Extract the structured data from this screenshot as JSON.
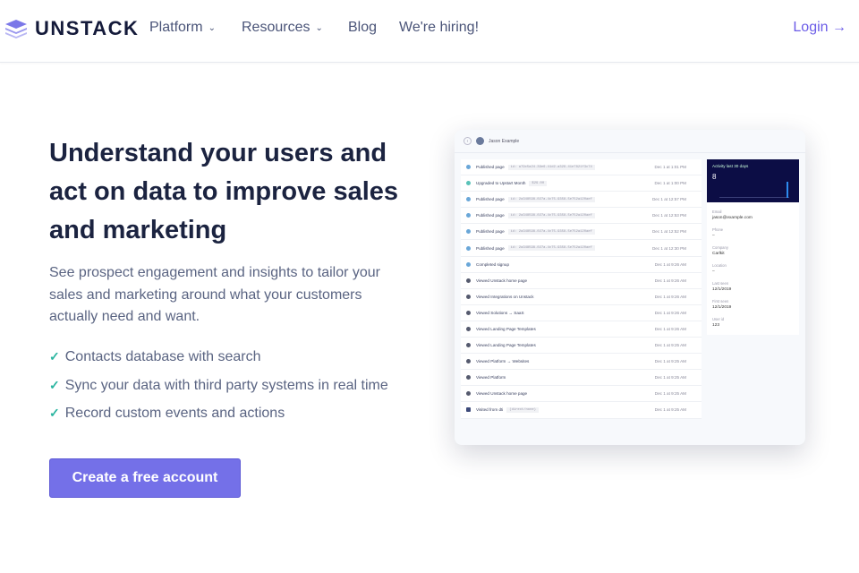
{
  "nav": {
    "brand": "UNSTACK",
    "items": [
      {
        "label": "Platform",
        "dropdown": true
      },
      {
        "label": "Resources",
        "dropdown": true
      },
      {
        "label": "Blog",
        "dropdown": false
      },
      {
        "label": "We're hiring!",
        "dropdown": false
      }
    ],
    "login": "Login →"
  },
  "hero": {
    "headline": "Understand your users and act on data to improve sales and marketing",
    "description": "See prospect engagement and insights to tailor your sales and marketing around what your customers actually need and want.",
    "features": [
      "Contacts database with search",
      "Sync your data with third party systems in real time",
      "Record custom events and actions"
    ],
    "cta": "Create a free account"
  },
  "mockup": {
    "contact_name": "Jason Example",
    "events": [
      {
        "label": "Published page",
        "code": "id: a79c5a24-39e6-41d2-a329-41e7821f3c74",
        "time": "Dec 1 at 1:01 PM",
        "icon": "page",
        "color": "#6aa7d8"
      },
      {
        "label": "Upgraded to Upstart Month",
        "code": "$29.00",
        "time": "Dec 1 at 1:00 PM",
        "icon": "upgrade",
        "color": "#59c2b8"
      },
      {
        "label": "Published page",
        "code": "id: 2a348598-027a-4c75-9358-5e752a120aef",
        "time": "Dec 1 at 12:57 PM",
        "icon": "page",
        "color": "#6aa7d8"
      },
      {
        "label": "Published page",
        "code": "id: 2a348598-027a-4c75-9358-5e752a120aef",
        "time": "Dec 1 at 12:53 PM",
        "icon": "page",
        "color": "#6aa7d8"
      },
      {
        "label": "Published page",
        "code": "id: 2a348598-027a-4c75-9358-5e752a120aef",
        "time": "Dec 1 at 12:52 PM",
        "icon": "page",
        "color": "#6aa7d8"
      },
      {
        "label": "Published page",
        "code": "id: 2a348598-027a-4c75-9358-5e752a120aef",
        "time": "Dec 1 at 12:30 PM",
        "icon": "page",
        "color": "#6aa7d8"
      },
      {
        "label": "Completed signup",
        "code": "",
        "time": "Dec 1 at 9:26 AM",
        "icon": "signup",
        "color": "#6aa7d8"
      },
      {
        "label": "Viewed Unstack home page",
        "code": "",
        "time": "Dec 1 at 9:26 AM",
        "icon": "eye",
        "color": "#555a6e"
      },
      {
        "label": "Viewed Integrations on Unstack",
        "code": "",
        "time": "Dec 1 at 9:26 AM",
        "icon": "eye",
        "color": "#555a6e"
      },
      {
        "label": "Viewed Solutions → SaaS",
        "code": "",
        "time": "Dec 1 at 9:26 AM",
        "icon": "eye",
        "color": "#555a6e"
      },
      {
        "label": "Viewed Landing Page Templates",
        "code": "",
        "time": "Dec 1 at 9:26 AM",
        "icon": "eye",
        "color": "#555a6e"
      },
      {
        "label": "Viewed Landing Page Templates",
        "code": "",
        "time": "Dec 1 at 9:25 AM",
        "icon": "eye",
        "color": "#555a6e"
      },
      {
        "label": "Viewed Platform → Websites",
        "code": "",
        "time": "Dec 1 at 9:25 AM",
        "icon": "eye",
        "color": "#555a6e"
      },
      {
        "label": "Viewed Platform",
        "code": "",
        "time": "Dec 1 at 9:25 AM",
        "icon": "eye",
        "color": "#555a6e"
      },
      {
        "label": "Viewed Unstack home page",
        "code": "",
        "time": "Dec 1 at 9:25 AM",
        "icon": "eye",
        "color": "#555a6e"
      },
      {
        "label": "Visited from dti",
        "code": "(direct/none)",
        "time": "Dec 1 at 9:25 AM",
        "icon": "calendar",
        "color": "#3d4a7a"
      }
    ],
    "activity": {
      "title": "Activity last 30 days",
      "count": "8"
    },
    "fields": [
      {
        "label": "Email",
        "value": "jason@example.com"
      },
      {
        "label": "Phone",
        "value": "–"
      },
      {
        "label": "Company",
        "value": "Carlkit"
      },
      {
        "label": "Location",
        "value": "–"
      },
      {
        "label": "Last seen",
        "value": "12/1/2019"
      },
      {
        "label": "First seen",
        "value": "12/1/2019"
      },
      {
        "label": "User id",
        "value": "123"
      }
    ]
  }
}
